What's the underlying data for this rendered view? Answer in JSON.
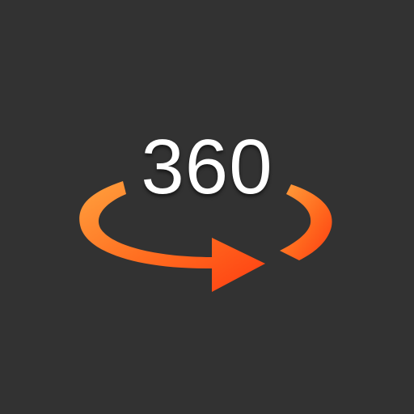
{
  "icon": {
    "label": "360",
    "glyph": "rotation-arrow-icon"
  },
  "colors": {
    "background": "#323232",
    "label": "#ffffff",
    "arrow_light": "#ff9a3c",
    "arrow_dark": "#ff4a14"
  }
}
